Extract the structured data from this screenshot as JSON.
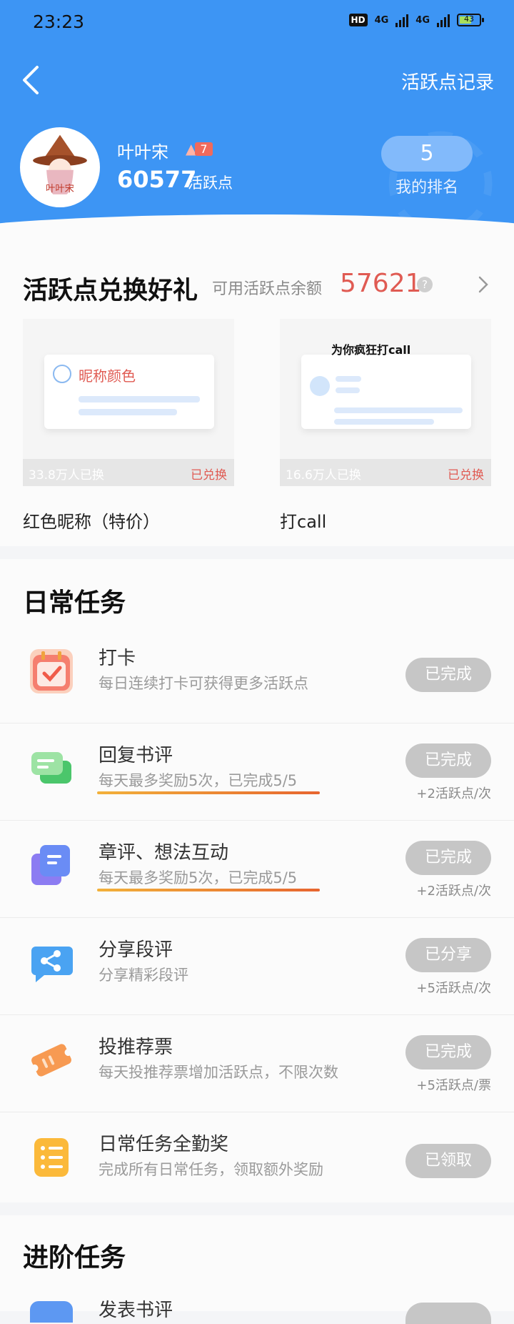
{
  "status_bar": {
    "time": "23:23",
    "hd": "HD",
    "net1": "4G",
    "net2": "4G",
    "battery": "43"
  },
  "header": {
    "record_link": "活跃点记录",
    "username": "叶叶宋",
    "fire_level": "7",
    "points": "60577",
    "points_unit": "活跃点",
    "rank": "5",
    "rank_label": "我的排名",
    "avatar_text": "叶叶宋"
  },
  "exchange": {
    "title": "活跃点兑换好礼",
    "balance_label": "可用活跃点余额",
    "balance": "57621",
    "help": "?",
    "gifts": [
      {
        "preview_text": "昵称颜色",
        "count": "33.8万人已换",
        "state": "已兑换",
        "name": "红色昵称（特价）"
      },
      {
        "preview_text": "为你疯狂打call",
        "count": "16.6万人已换",
        "state": "已兑换",
        "name": "打call"
      }
    ]
  },
  "daily": {
    "title": "日常任务",
    "tasks": [
      {
        "name": "打卡",
        "desc": "每日连续打卡可获得更多活跃点",
        "button": "已完成",
        "reward": "",
        "icon": "calendar-check-icon"
      },
      {
        "name": "回复书评",
        "desc": "每天最多奖励5次，已完成5/5",
        "button": "已完成",
        "reward": "+2活跃点/次",
        "icon": "chat-bubbles-icon"
      },
      {
        "name": "章评、想法互动",
        "desc": "每天最多奖励5次，已完成5/5",
        "button": "已完成",
        "reward": "+2活跃点/次",
        "icon": "notes-icon"
      },
      {
        "name": "分享段评",
        "desc": "分享精彩段评",
        "button": "已分享",
        "reward": "+5活跃点/次",
        "icon": "share-icon"
      },
      {
        "name": "投推荐票",
        "desc": "每天投推荐票增加活跃点，不限次数",
        "button": "已完成",
        "reward": "+5活跃点/票",
        "icon": "ticket-icon"
      },
      {
        "name": "日常任务全勤奖",
        "desc": "完成所有日常任务，领取额外奖励",
        "button": "已领取",
        "reward": "",
        "icon": "list-icon"
      }
    ]
  },
  "advanced": {
    "title": "进阶任务",
    "first_task_name": "发表书评"
  },
  "colors": {
    "header_blue": "#3d95f4",
    "accent_red": "#e05b53",
    "done_gray": "#c6c6c6"
  }
}
